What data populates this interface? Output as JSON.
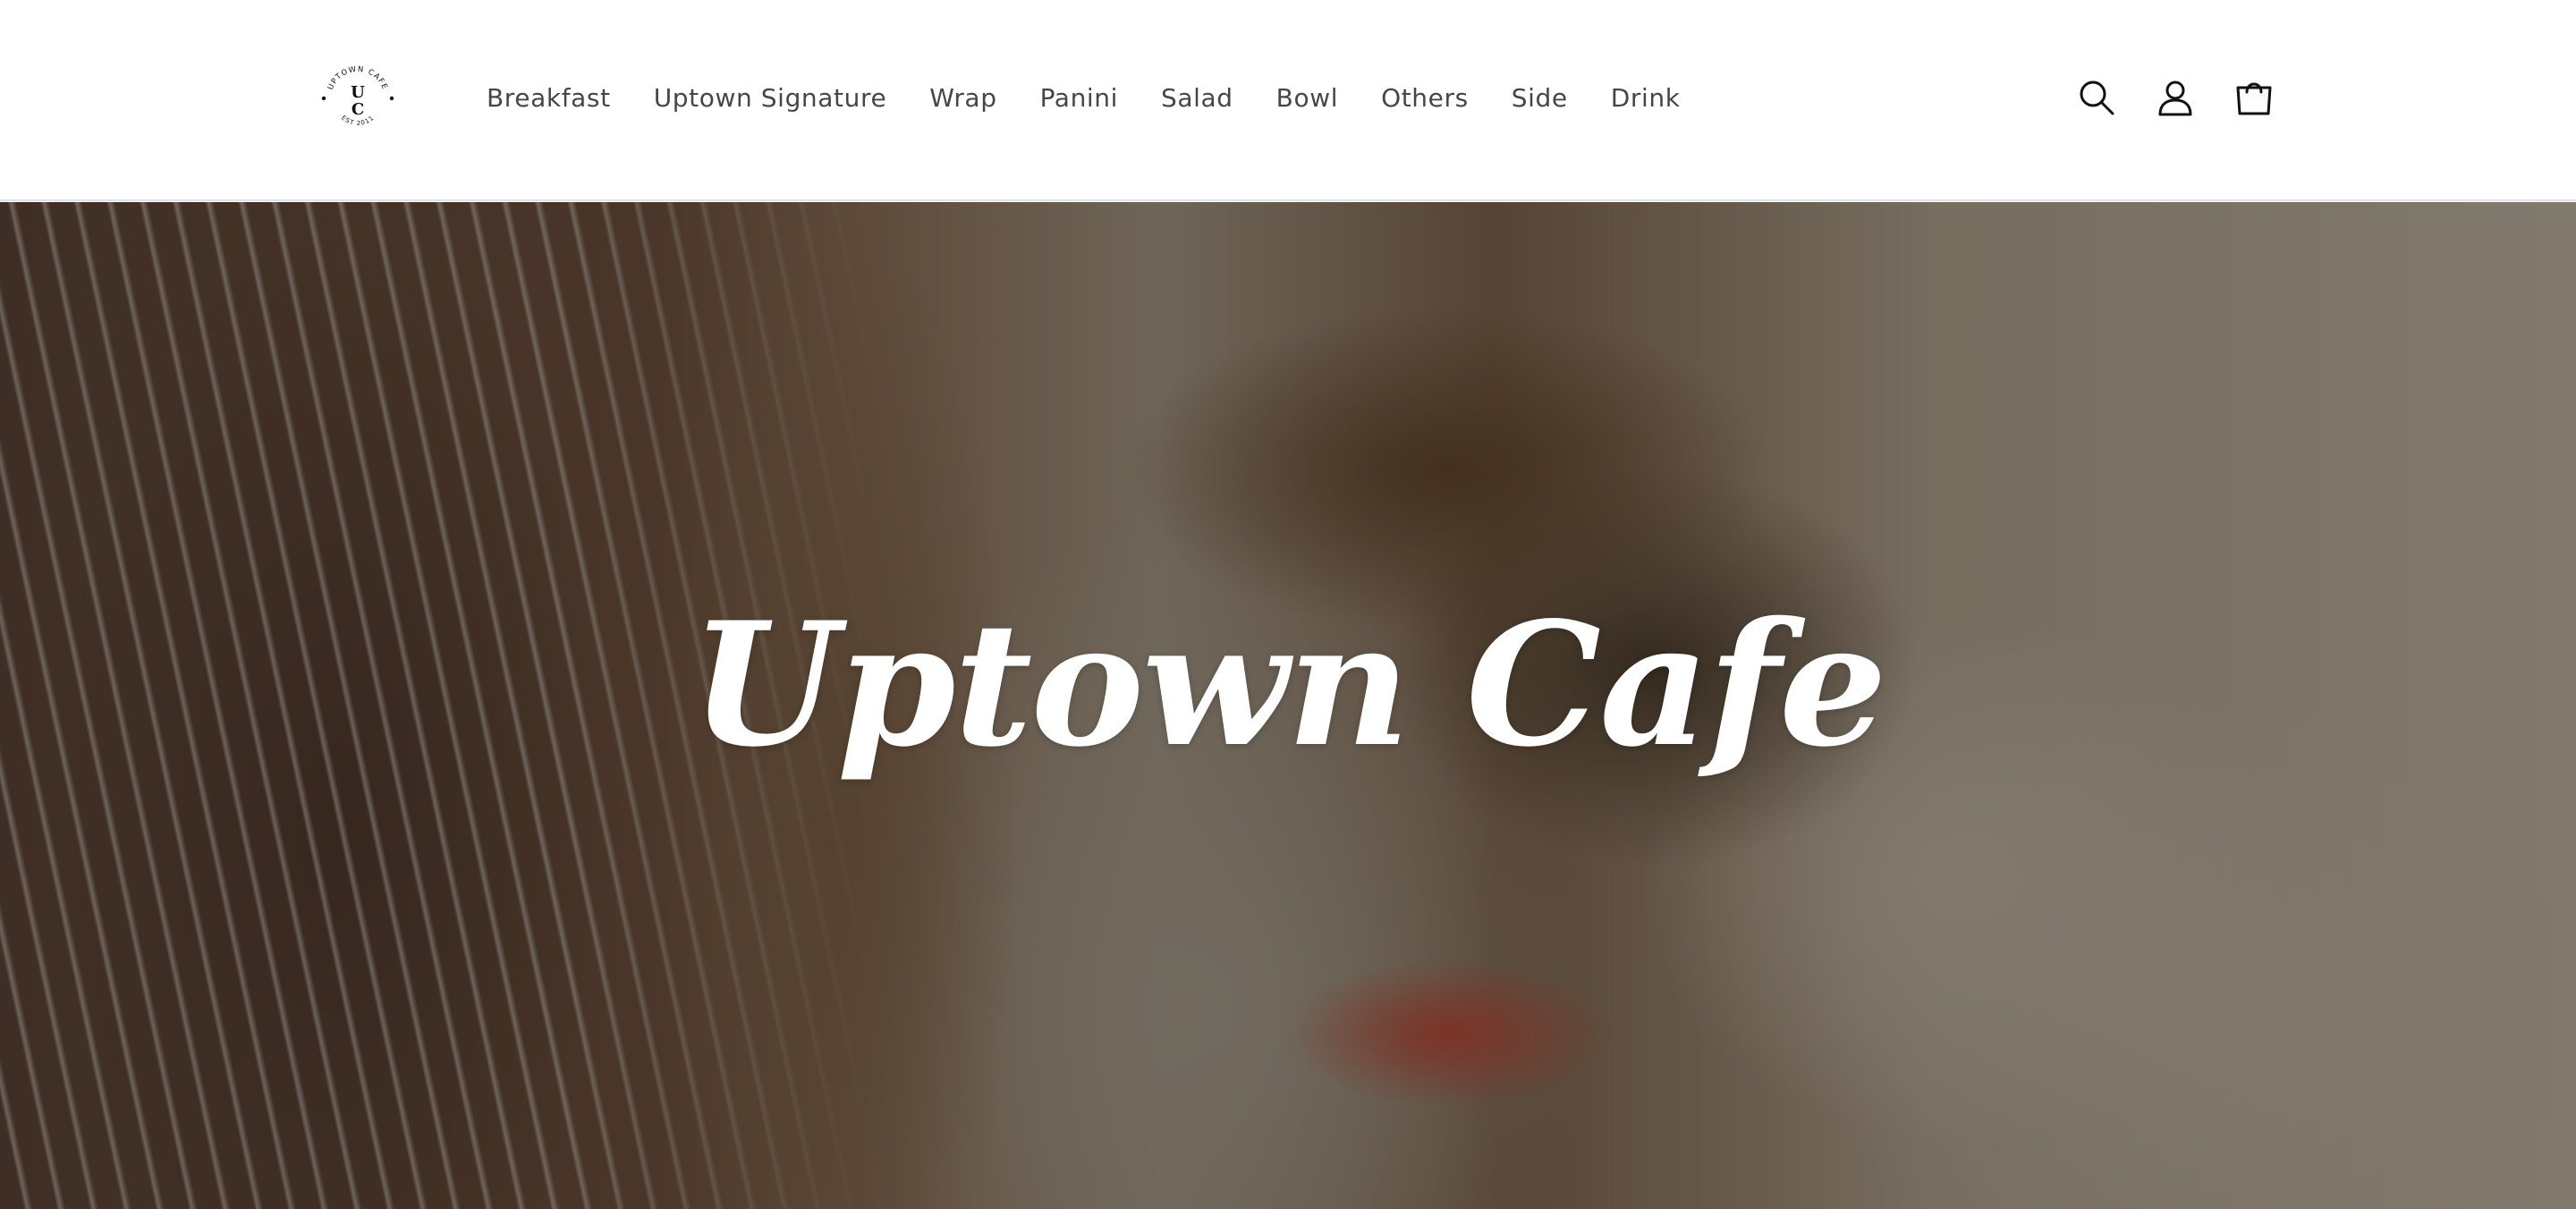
{
  "brand": {
    "logo_ring_text": "UPTOWN CAFE",
    "logo_monogram_top": "U",
    "logo_monogram_bottom": "C",
    "logo_est": "EST 2011"
  },
  "nav": {
    "items": [
      {
        "label": "Breakfast"
      },
      {
        "label": "Uptown Signature"
      },
      {
        "label": "Wrap"
      },
      {
        "label": "Panini"
      },
      {
        "label": "Salad"
      },
      {
        "label": "Bowl"
      },
      {
        "label": "Others"
      },
      {
        "label": "Side"
      },
      {
        "label": "Drink"
      }
    ]
  },
  "header_icons": [
    "search-icon",
    "account-icon",
    "cart-icon"
  ],
  "hero": {
    "title": "Uptown Cafe"
  },
  "colors": {
    "text": "#121212",
    "header_bg": "#ffffff",
    "hero_title": "#ffffff"
  }
}
